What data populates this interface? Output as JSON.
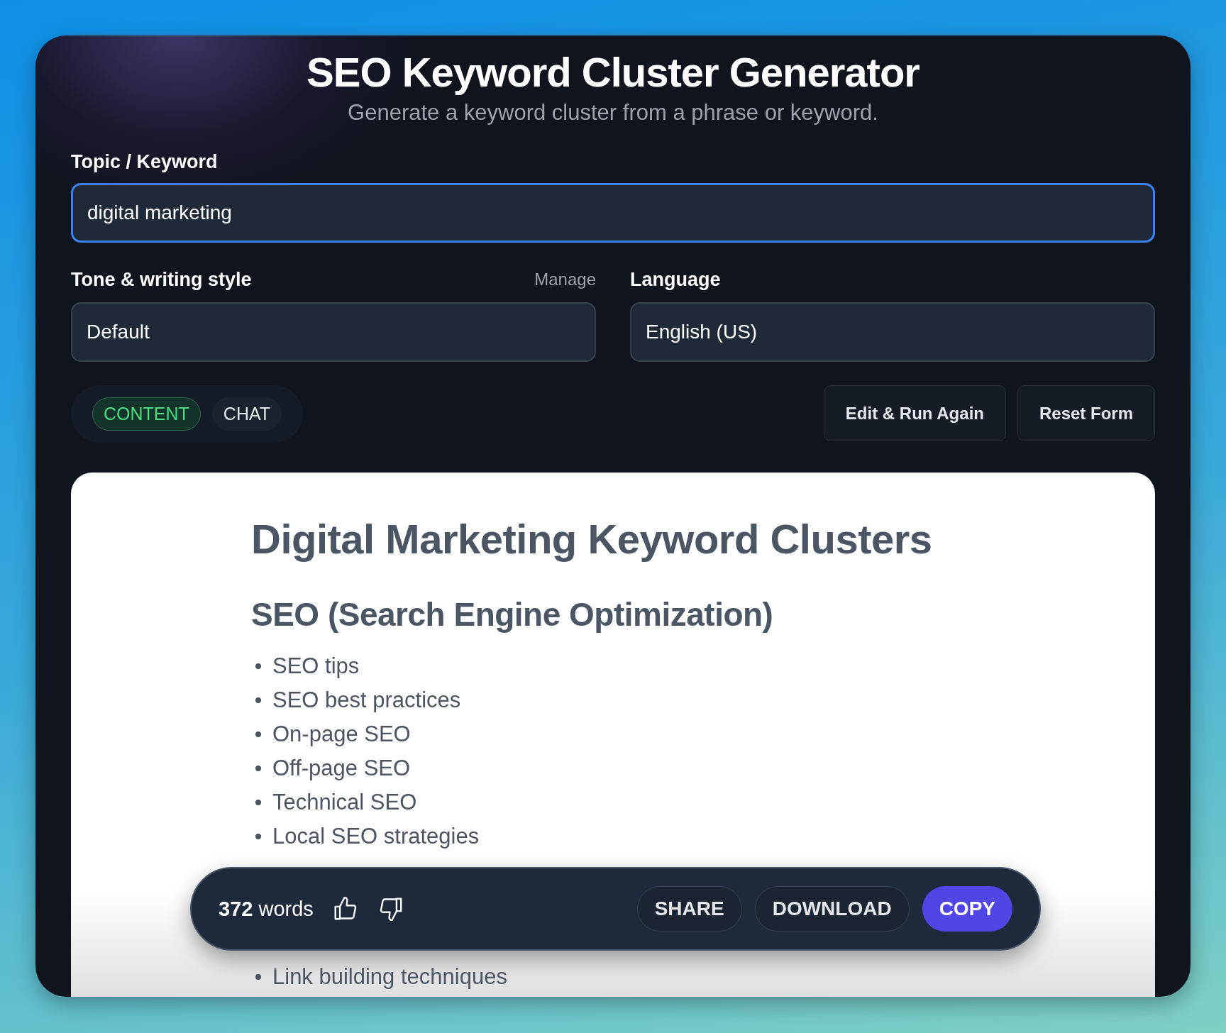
{
  "header": {
    "title": "SEO Keyword Cluster Generator",
    "subtitle": "Generate a keyword cluster from a phrase or keyword."
  },
  "topic": {
    "label": "Topic / Keyword",
    "value": "digital marketing",
    "focused": true
  },
  "tone": {
    "label": "Tone & writing style",
    "link": "Manage",
    "value": "Default"
  },
  "language": {
    "label": "Language",
    "value": "English (US)"
  },
  "modes": [
    {
      "label": "CONTENT",
      "selected": true
    },
    {
      "label": "CHAT",
      "selected": false
    }
  ],
  "actions": [
    "Edit & Run Again",
    "Reset Form"
  ],
  "document": {
    "title": "Digital Marketing Keyword Clusters",
    "sections": [
      {
        "heading": "SEO (Search Engine Optimization)",
        "items": [
          "SEO tips",
          "SEO best practices",
          "On-page SEO",
          "Off-page SEO",
          "Technical SEO",
          "Local SEO strategies"
        ]
      }
    ],
    "partial_item": "Link building techniques"
  },
  "toolbar": {
    "word_count": "**372** words",
    "buttons": [
      {
        "label": "SHARE",
        "kind": "secondary"
      },
      {
        "label": "DOWNLOAD",
        "kind": "secondary"
      },
      {
        "label": "COPY",
        "kind": "primary"
      }
    ]
  }
}
